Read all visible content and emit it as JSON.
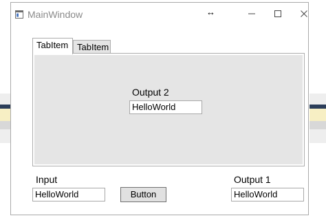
{
  "window": {
    "title": "MainWindow",
    "resize_cursor": "↔",
    "controls": {
      "minimize": "—",
      "maximize": "☐",
      "close": "✕"
    }
  },
  "tabs": [
    {
      "label": "TabItem",
      "selected": true
    },
    {
      "label": "TabItem",
      "selected": false
    }
  ],
  "tab_content": {
    "output2_label": "Output 2",
    "output2_value": "HelloWorld"
  },
  "bottom": {
    "input_label": "Input",
    "input_value": "HelloWorld",
    "button_label": "Button",
    "output1_label": "Output 1",
    "output1_value": "HelloWorld"
  }
}
